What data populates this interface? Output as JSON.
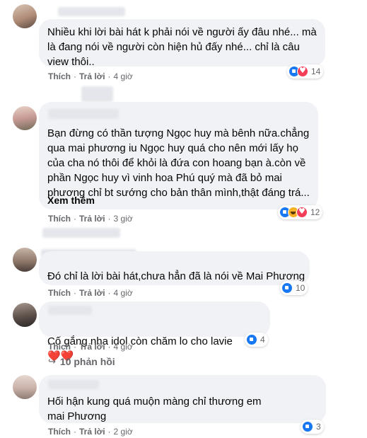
{
  "actions": {
    "like_label": "Thích",
    "reply_label": "Trả lời",
    "sep": "·"
  },
  "see_more": "Xem thêm",
  "replies_link": {
    "label": "10 phản hồi",
    "arrow": "↪"
  },
  "comments": [
    {
      "text": "Nhiều khi lời bài hát k phải nói về người ấy đâu nhé... mà là đang nói về người còn hiện hủ đấy nhé... chỉ là câu view thôi..",
      "time": "4 giờ",
      "reactions": [
        "like",
        "heart"
      ],
      "count": "14"
    },
    {
      "text": "Bạn đừng có thần tượng Ngọc huy mà bênh nữa.chẳng qua mai phương iu Ngọc huy quá cho nên mới lấy họ của cha nó thôi để khỏi là đứa con hoang bạn à.còn về phần Ngọc huy vì vinh hoa Phú quý mà đã bỏ mai phương chỉ bt sướng cho bản thân mình,thật đáng trá...",
      "time": "3 giờ",
      "reactions": [
        "like",
        "haha",
        "heart"
      ],
      "count": "12"
    },
    {
      "text": "Đó chỉ là lời bài hát,chưa hẳn đã là nói về Mai Phương",
      "time": "4 giờ",
      "reactions": [
        "like"
      ],
      "count": "10"
    },
    {
      "text": "Cố gắng nha idol còn chăm lo cho lavie",
      "emoji": "❤️❤️",
      "time": "4 giờ",
      "reactions": [
        "like"
      ],
      "count": "4"
    },
    {
      "text": "Hối hận kung quá muộn màng chỉ thương em mai Phương",
      "time": "2 giờ",
      "reactions": [
        "like"
      ],
      "count": "3"
    }
  ]
}
